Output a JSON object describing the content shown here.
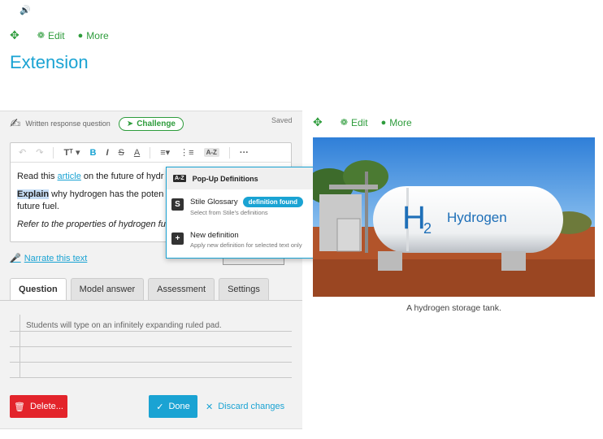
{
  "top_toolbar": {
    "edit": "Edit",
    "more": "More"
  },
  "page_title": "Extension",
  "question": {
    "type": "Written response question",
    "challenge": "Challenge",
    "saved": "Saved",
    "text": {
      "p1_before": "Read this ",
      "p1_link": "article",
      "p1_after": " on the future of hydr",
      "p2_bold": "Explain",
      "p2_rest": " why hydrogen has the poten",
      "p2_line2": "future fuel.",
      "p3": "Refer to the properties of hydrogen fue"
    },
    "narrate": "Narrate this text",
    "tabs": [
      "Question",
      "Model answer",
      "Assessment",
      "Settings"
    ],
    "ruled_placeholder": "Students will type on an infinitely expanding ruled pad.",
    "delete": "Delete...",
    "done": "Done",
    "discard": "Discard changes"
  },
  "popup": {
    "title": "Pop-Up Definitions",
    "glossary_title": "Stile Glossary",
    "glossary_badge": "definition found",
    "glossary_sub": "Select from Stile's definitions",
    "new_title": "New definition",
    "new_sub": "Apply new definition for selected text only"
  },
  "right_toolbar": {
    "edit": "Edit",
    "more": "More"
  },
  "image": {
    "caption": "A hydrogen storage tank.",
    "tank_label": "Hydrogen",
    "tank_symbol": "H",
    "tank_subscript": "2"
  },
  "colors": {
    "accent_blue": "#1aa3d3",
    "green": "#2e9c3c",
    "danger": "#e3242b"
  }
}
